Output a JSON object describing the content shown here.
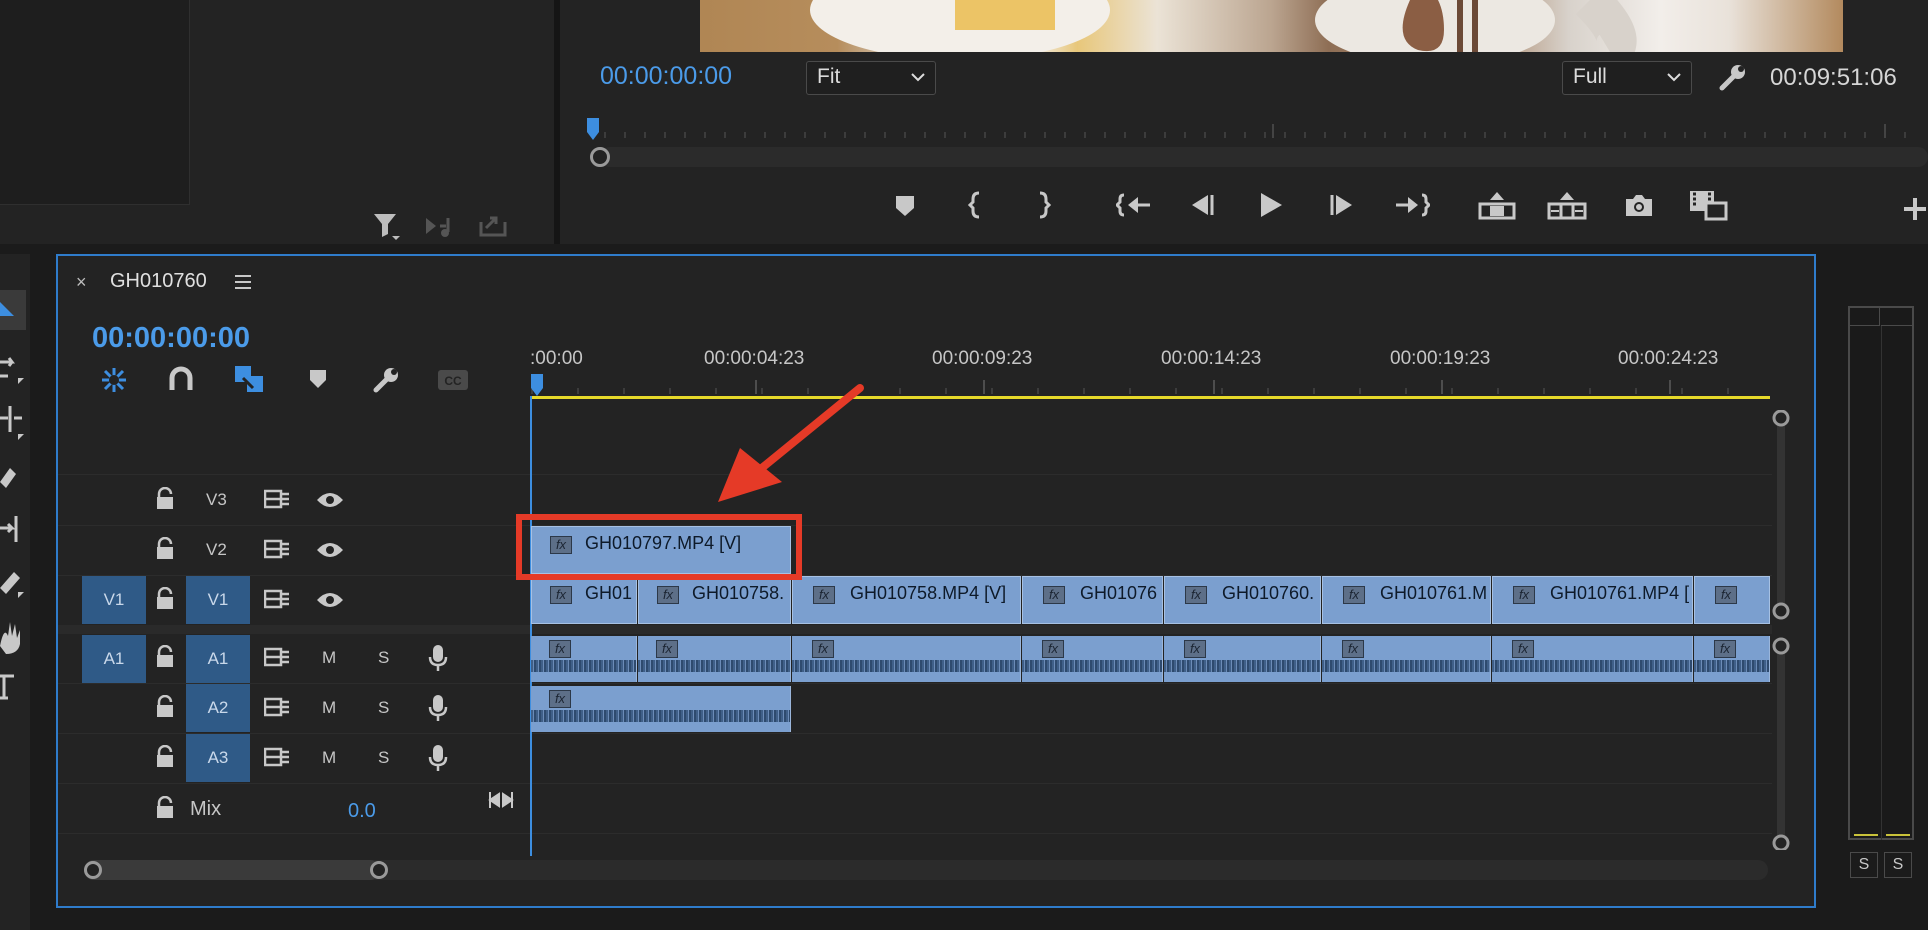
{
  "program_monitor": {
    "current_timecode": "00:00:00:00",
    "zoom_select": "Fit",
    "resolution_select": "Full",
    "duration_timecode": "00:09:51:06"
  },
  "timeline": {
    "sequence_name": "GH010760",
    "current_timecode": "00:00:00:00",
    "ruler_ticks": [
      ":00:00",
      "00:00:04:23",
      "00:00:09:23",
      "00:00:14:23",
      "00:00:19:23",
      "00:00:24:23"
    ],
    "tracks": {
      "v3": "V3",
      "v2": "V2",
      "v1_src": "V1",
      "v1": "V1",
      "a1_src": "A1",
      "a1": "A1",
      "a2": "A2",
      "a3": "A3",
      "mute": "M",
      "solo": "S",
      "mix_label": "Mix",
      "mix_value": "0.0"
    },
    "v2_clip": "GH010797.MP4 [V]",
    "v1_clips": [
      "GH01",
      "GH010758.",
      "GH010758.MP4 [V]",
      "GH01076",
      "GH010760.",
      "GH010761.M",
      "GH010761.MP4 [",
      ""
    ],
    "fx_label": "fx"
  },
  "audio_meter": {
    "solo_left": "S",
    "solo_right": "S"
  },
  "colors": {
    "accent_blue": "#4b9be9",
    "panel_border": "#2f7ccb",
    "clip_blue": "#7b9fcf",
    "annotation_red": "#e53a27",
    "work_area_yellow": "#e6d92a"
  },
  "icons": [
    "filter-icon",
    "automate-icon",
    "export-icon",
    "marker-icon",
    "mark-in-icon",
    "mark-out-icon",
    "go-to-in-icon",
    "step-back-icon",
    "play-icon",
    "step-forward-icon",
    "go-to-out-icon",
    "lift-icon",
    "extract-icon",
    "camera-icon",
    "compare-icon",
    "add-icon",
    "wrench-icon",
    "snap-icon",
    "linked-selection-icon",
    "captions-icon",
    "lock-icon",
    "toggle-output-icon",
    "eye-icon",
    "microphone-icon"
  ]
}
